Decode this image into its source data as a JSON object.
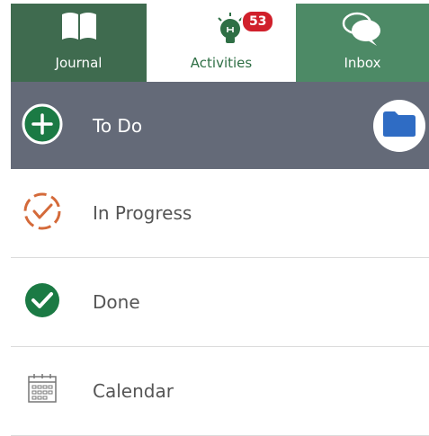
{
  "tabs": [
    {
      "label": "Journal",
      "icon": "book-icon"
    },
    {
      "label": "Activities",
      "icon": "lightbulb-icon",
      "badge": "53"
    },
    {
      "label": "Inbox",
      "icon": "chat-bubbles-icon"
    }
  ],
  "list": {
    "items": [
      {
        "label": "To Do",
        "icon": "plus-circle-icon"
      },
      {
        "label": "In Progress",
        "icon": "progress-check-icon"
      },
      {
        "label": "Done",
        "icon": "check-circle-icon"
      },
      {
        "label": "Calendar",
        "icon": "calendar-icon"
      }
    ],
    "folder_icon": "folder-icon"
  },
  "colors": {
    "journal_tab": "#3f6b4f",
    "inbox_tab": "#4d8a66",
    "active_row": "#646a78",
    "green": "#1b7a44",
    "badge": "#d0202b",
    "in_progress": "#d46a3a",
    "folder": "#2f6cc4"
  }
}
